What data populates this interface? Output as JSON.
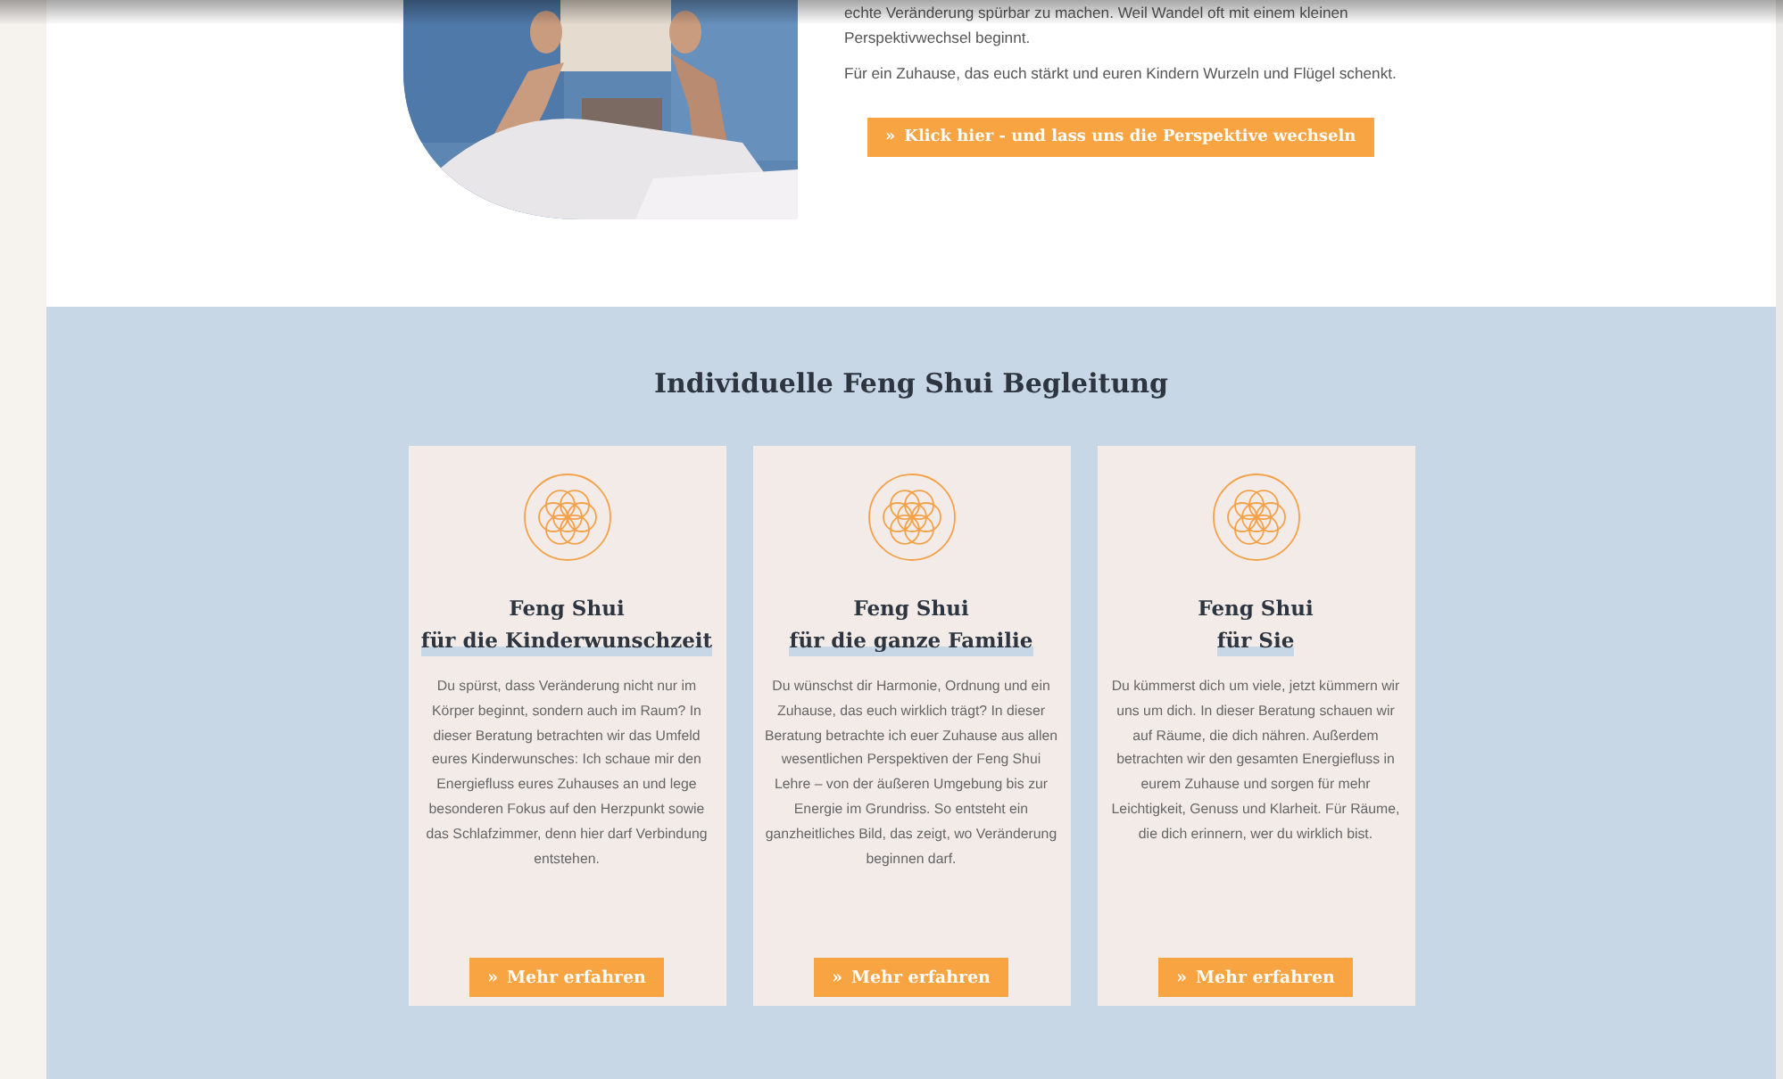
{
  "intro": {
    "paragraphs": [
      "echte Veränderung spürbar zu machen. Weil Wandel oft mit einem kleinen Perspektivwechsel beginnt.",
      "Für ein Zuhause, das euch stärkt und euren Kindern Wurzeln und Flügel schenkt."
    ],
    "button": {
      "icon": "»",
      "label": "Klick hier - und lass uns die Perspektive wechseln"
    }
  },
  "services": {
    "heading": "Individuelle Feng Shui Begleitung",
    "cards": [
      {
        "title_line_1": "Feng Shui",
        "title_line_2": "für die Kinderwunschzeit",
        "text": "Du spürst, dass Veränderung nicht nur im Körper beginnt, sondern auch im Raum? In dieser Beratung betrachten wir das Umfeld eures Kinderwunsches: Ich schaue mir den Energiefluss eures Zuhauses an und lege besonderen Fokus auf den Herzpunkt sowie das Schlafzimmer, denn hier darf Verbindung entstehen.",
        "button": {
          "icon": "»",
          "label": "Mehr erfahren"
        }
      },
      {
        "title_line_1": "Feng Shui",
        "title_line_2": "für die ganze Familie",
        "text": "Du wünschst dir Harmonie, Ordnung und ein Zuhause, das euch wirklich trägt? In dieser Beratung betrachte ich euer Zuhause aus allen wesentlichen Perspektiven der Feng Shui Lehre – von der äußeren Umgebung bis zur Energie im Grundriss. So entsteht ein ganzheitliches Bild, das zeigt, wo Veränderung beginnen darf.",
        "button": {
          "icon": "»",
          "label": "Mehr erfahren"
        }
      },
      {
        "title_line_1": "Feng Shui",
        "title_line_2": "für Sie",
        "text": "Du kümmerst dich um viele, jetzt kümmern wir uns um dich. In dieser Beratung schauen wir auf Räume, die dich nähren. Außerdem betrachten wir den gesamten Energiefluss in eurem Zuhause und sorgen für mehr Leichtigkeit, Genuss und Klarheit. Für Räume, die dich erinnern, wer du wirklich bist.",
        "button": {
          "icon": "»",
          "label": "Mehr erfahren"
        }
      }
    ]
  }
}
